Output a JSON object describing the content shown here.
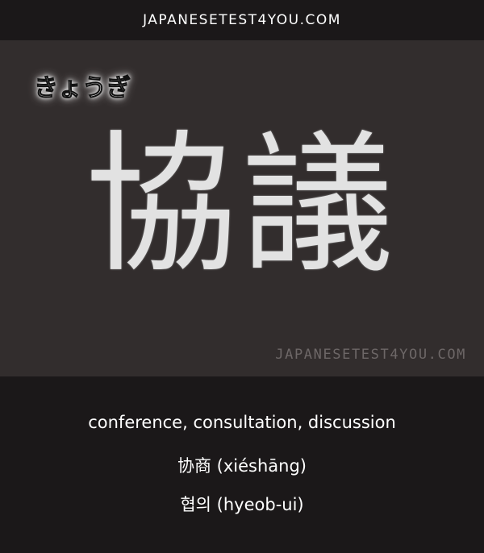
{
  "header": {
    "site": "JAPANESETEST4YOU.COM"
  },
  "card": {
    "reading": "きょうぎ",
    "kanji": "協議",
    "watermark": "JAPANESETEST4YOU.COM"
  },
  "meanings": {
    "english": "conference, consultation, discussion",
    "chinese": "协商 (xiéshāng)",
    "korean": "협의 (hyeob-ui)"
  }
}
